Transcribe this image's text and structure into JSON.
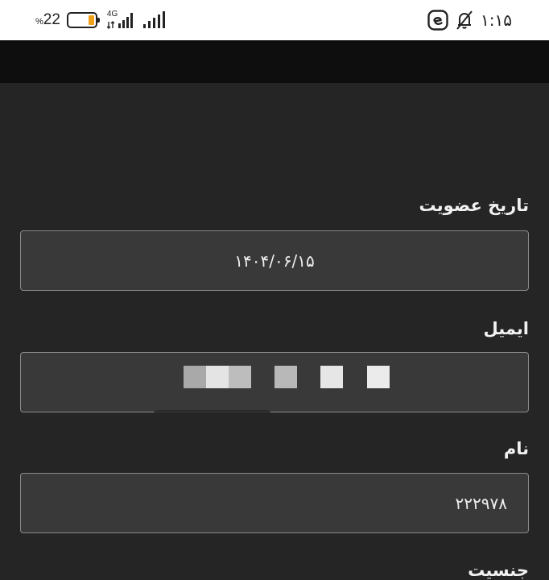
{
  "status_bar": {
    "battery_percent": "22",
    "percent_sign": "%",
    "network_type": "4G",
    "time": "۱:۱۵",
    "battery_level": 0.22,
    "icons": [
      "battery-icon",
      "signal-4g-icon",
      "signal-icon",
      "app-notification-icon",
      "bell-off-icon"
    ]
  },
  "profile": {
    "fields": [
      {
        "label": "تاریخ عضویت",
        "value": "۱۴۰۴/۰۶/۱۵"
      },
      {
        "label": "ایمیل",
        "value": ""
      },
      {
        "label": "نام",
        "value": "۲۲۲۹۷۸"
      },
      {
        "label": "جنسیت"
      }
    ]
  },
  "colors": {
    "background": "#252525",
    "field_bg": "#393939",
    "field_border": "#8a8a8a",
    "top_bar": "#0e0e0e",
    "battery_fill": "#f0a21a"
  }
}
